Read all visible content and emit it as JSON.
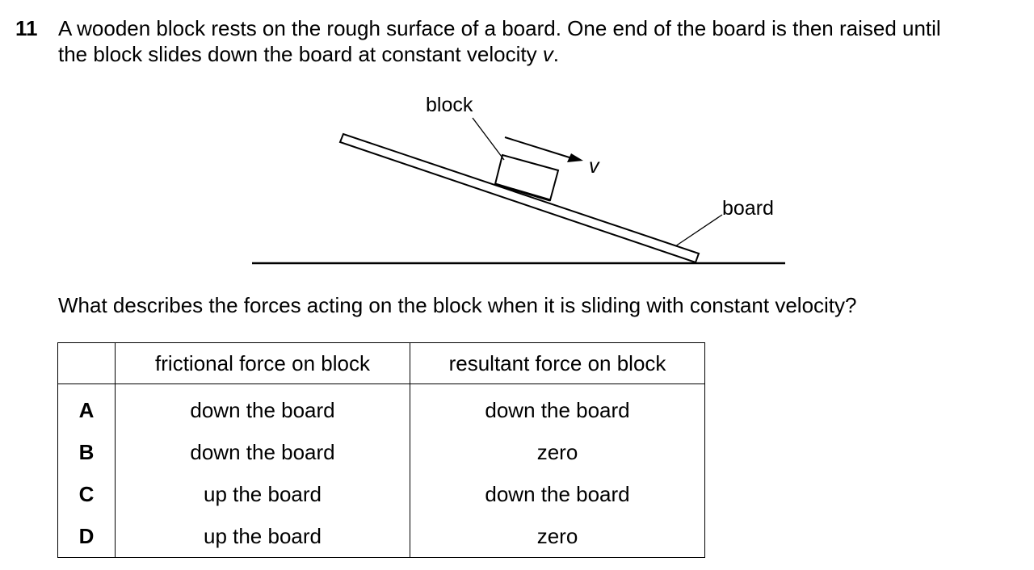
{
  "question": {
    "number": "11",
    "stem_line1": "A wooden block rests on the rough surface of a board. One end of the board is then raised until",
    "stem_line2": "the block slides down the board at constant velocity ",
    "stem_var": "v",
    "stem_end": ".",
    "prompt": "What describes the forces acting on the block when it is sliding with constant velocity?"
  },
  "diagram": {
    "block_label": "block",
    "velocity_label": "v",
    "board_label": "board"
  },
  "table": {
    "headers": [
      "",
      "frictional force on block",
      "resultant force on block"
    ],
    "rows": [
      {
        "option": "A",
        "friction": "down the board",
        "resultant": "down the board"
      },
      {
        "option": "B",
        "friction": "down the board",
        "resultant": "zero"
      },
      {
        "option": "C",
        "friction": "up the board",
        "resultant": "down the board"
      },
      {
        "option": "D",
        "friction": "up the board",
        "resultant": "zero"
      }
    ]
  }
}
